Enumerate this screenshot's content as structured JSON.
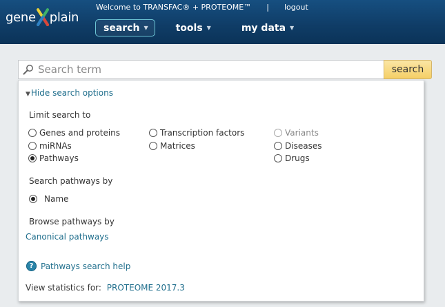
{
  "header": {
    "logo": {
      "left": "gene",
      "right": "plain"
    },
    "welcome": "Welcome to TRANSFAC® + PROTEOME™",
    "separator": "|",
    "logout": "logout",
    "nav": [
      {
        "label": "search",
        "active": true
      },
      {
        "label": "tools",
        "active": false
      },
      {
        "label": "my data",
        "active": false
      }
    ]
  },
  "search": {
    "placeholder": "Search term",
    "button_label": "search"
  },
  "options": {
    "toggle_label": "Hide search options",
    "limit_label": "Limit search to",
    "radios": [
      {
        "label": "Genes and proteins",
        "checked": false,
        "disabled": false
      },
      {
        "label": "miRNAs",
        "checked": false,
        "disabled": false
      },
      {
        "label": "Pathways",
        "checked": true,
        "disabled": false
      },
      {
        "label": "Transcription factors",
        "checked": false,
        "disabled": false
      },
      {
        "label": "Matrices",
        "checked": false,
        "disabled": false
      },
      {
        "label": "Variants",
        "checked": false,
        "disabled": true
      },
      {
        "label": "Diseases",
        "checked": false,
        "disabled": false
      },
      {
        "label": "Drugs",
        "checked": false,
        "disabled": false
      }
    ],
    "search_by_label": "Search pathways by",
    "search_by_option": {
      "label": "Name",
      "checked": true
    },
    "browse_label": "Browse pathways by",
    "browse_link": "Canonical pathways",
    "help_link": "Pathways search help",
    "stats_label": "View statistics for:",
    "stats_link": "PROTEOME 2017.3"
  },
  "colors": {
    "header_bg": "#0f3c66",
    "link": "#1f6e8c",
    "search_button": "#f5cf66",
    "nav_active_border": "#6ec6d6"
  }
}
